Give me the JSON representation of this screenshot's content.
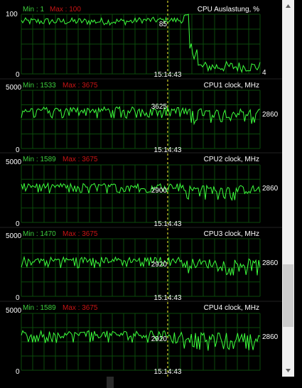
{
  "playhead_time": "15:14:43",
  "colors": {
    "graph_line": "#3cff3c",
    "grid": "#0b4a0b",
    "min_text": "#3ccc3c",
    "max_text": "#c81414",
    "cursor": "#ffff33",
    "text": "#ffffff"
  },
  "scrollbar": {
    "position_fraction": 0.72
  },
  "chart_data": [
    {
      "type": "line",
      "title": "CPU Auslastung, %",
      "min_label": "Min : 1",
      "max_label": "Max : 100",
      "y_max_label": "100",
      "y_min_label": "0",
      "ylim": [
        0,
        100
      ],
      "cursor_value": "85",
      "current_value": "4",
      "segments": [
        {
          "from": 0.0,
          "to": 0.48,
          "level": 88,
          "noise": 6
        },
        {
          "from": 0.48,
          "to": 0.68,
          "level": 90,
          "noise": 5
        },
        {
          "from": 0.68,
          "to": 0.7,
          "level": 97,
          "noise": 3
        },
        {
          "from": 0.7,
          "to": 0.74,
          "level": 40,
          "noise": 15
        },
        {
          "from": 0.74,
          "to": 1.0,
          "level": 12,
          "noise": 9
        }
      ]
    },
    {
      "type": "line",
      "title": "CPU1 clock, MHz",
      "min_label": "Min : 1533",
      "max_label": "Max : 3675",
      "y_max_label": "5000",
      "y_min_label": "0",
      "ylim": [
        0,
        5000
      ],
      "cursor_value": "3625",
      "current_value": "2860",
      "segments": [
        {
          "from": 0.0,
          "to": 0.68,
          "level": 3300,
          "noise": 280
        },
        {
          "from": 0.68,
          "to": 1.0,
          "level": 3050,
          "noise": 400
        }
      ]
    },
    {
      "type": "line",
      "title": "CPU2 clock, MHz",
      "min_label": "Min : 1589",
      "max_label": "Max : 3675",
      "y_max_label": "5000",
      "y_min_label": "0",
      "ylim": [
        0,
        5000
      ],
      "cursor_value": "2900",
      "current_value": "2860",
      "segments": [
        {
          "from": 0.0,
          "to": 0.68,
          "level": 3150,
          "noise": 250
        },
        {
          "from": 0.68,
          "to": 1.0,
          "level": 2850,
          "noise": 380
        }
      ]
    },
    {
      "type": "line",
      "title": "CPU3 clock, MHz",
      "min_label": "Min : 1470",
      "max_label": "Max : 3675",
      "y_max_label": "5000",
      "y_min_label": "0",
      "ylim": [
        0,
        5000
      ],
      "cursor_value": "2920",
      "current_value": "2860",
      "segments": [
        {
          "from": 0.0,
          "to": 0.68,
          "level": 3150,
          "noise": 280
        },
        {
          "from": 0.68,
          "to": 1.0,
          "level": 2850,
          "noise": 420
        }
      ]
    },
    {
      "type": "line",
      "title": "CPU4 clock, MHz",
      "min_label": "Min : 1589",
      "max_label": "Max : 3675",
      "y_max_label": "5000",
      "y_min_label": "0",
      "ylim": [
        0,
        5000
      ],
      "cursor_value": "2920",
      "current_value": "2860",
      "segments": [
        {
          "from": 0.0,
          "to": 0.68,
          "level": 3150,
          "noise": 320
        },
        {
          "from": 0.68,
          "to": 1.0,
          "level": 2850,
          "noise": 450
        }
      ]
    }
  ]
}
